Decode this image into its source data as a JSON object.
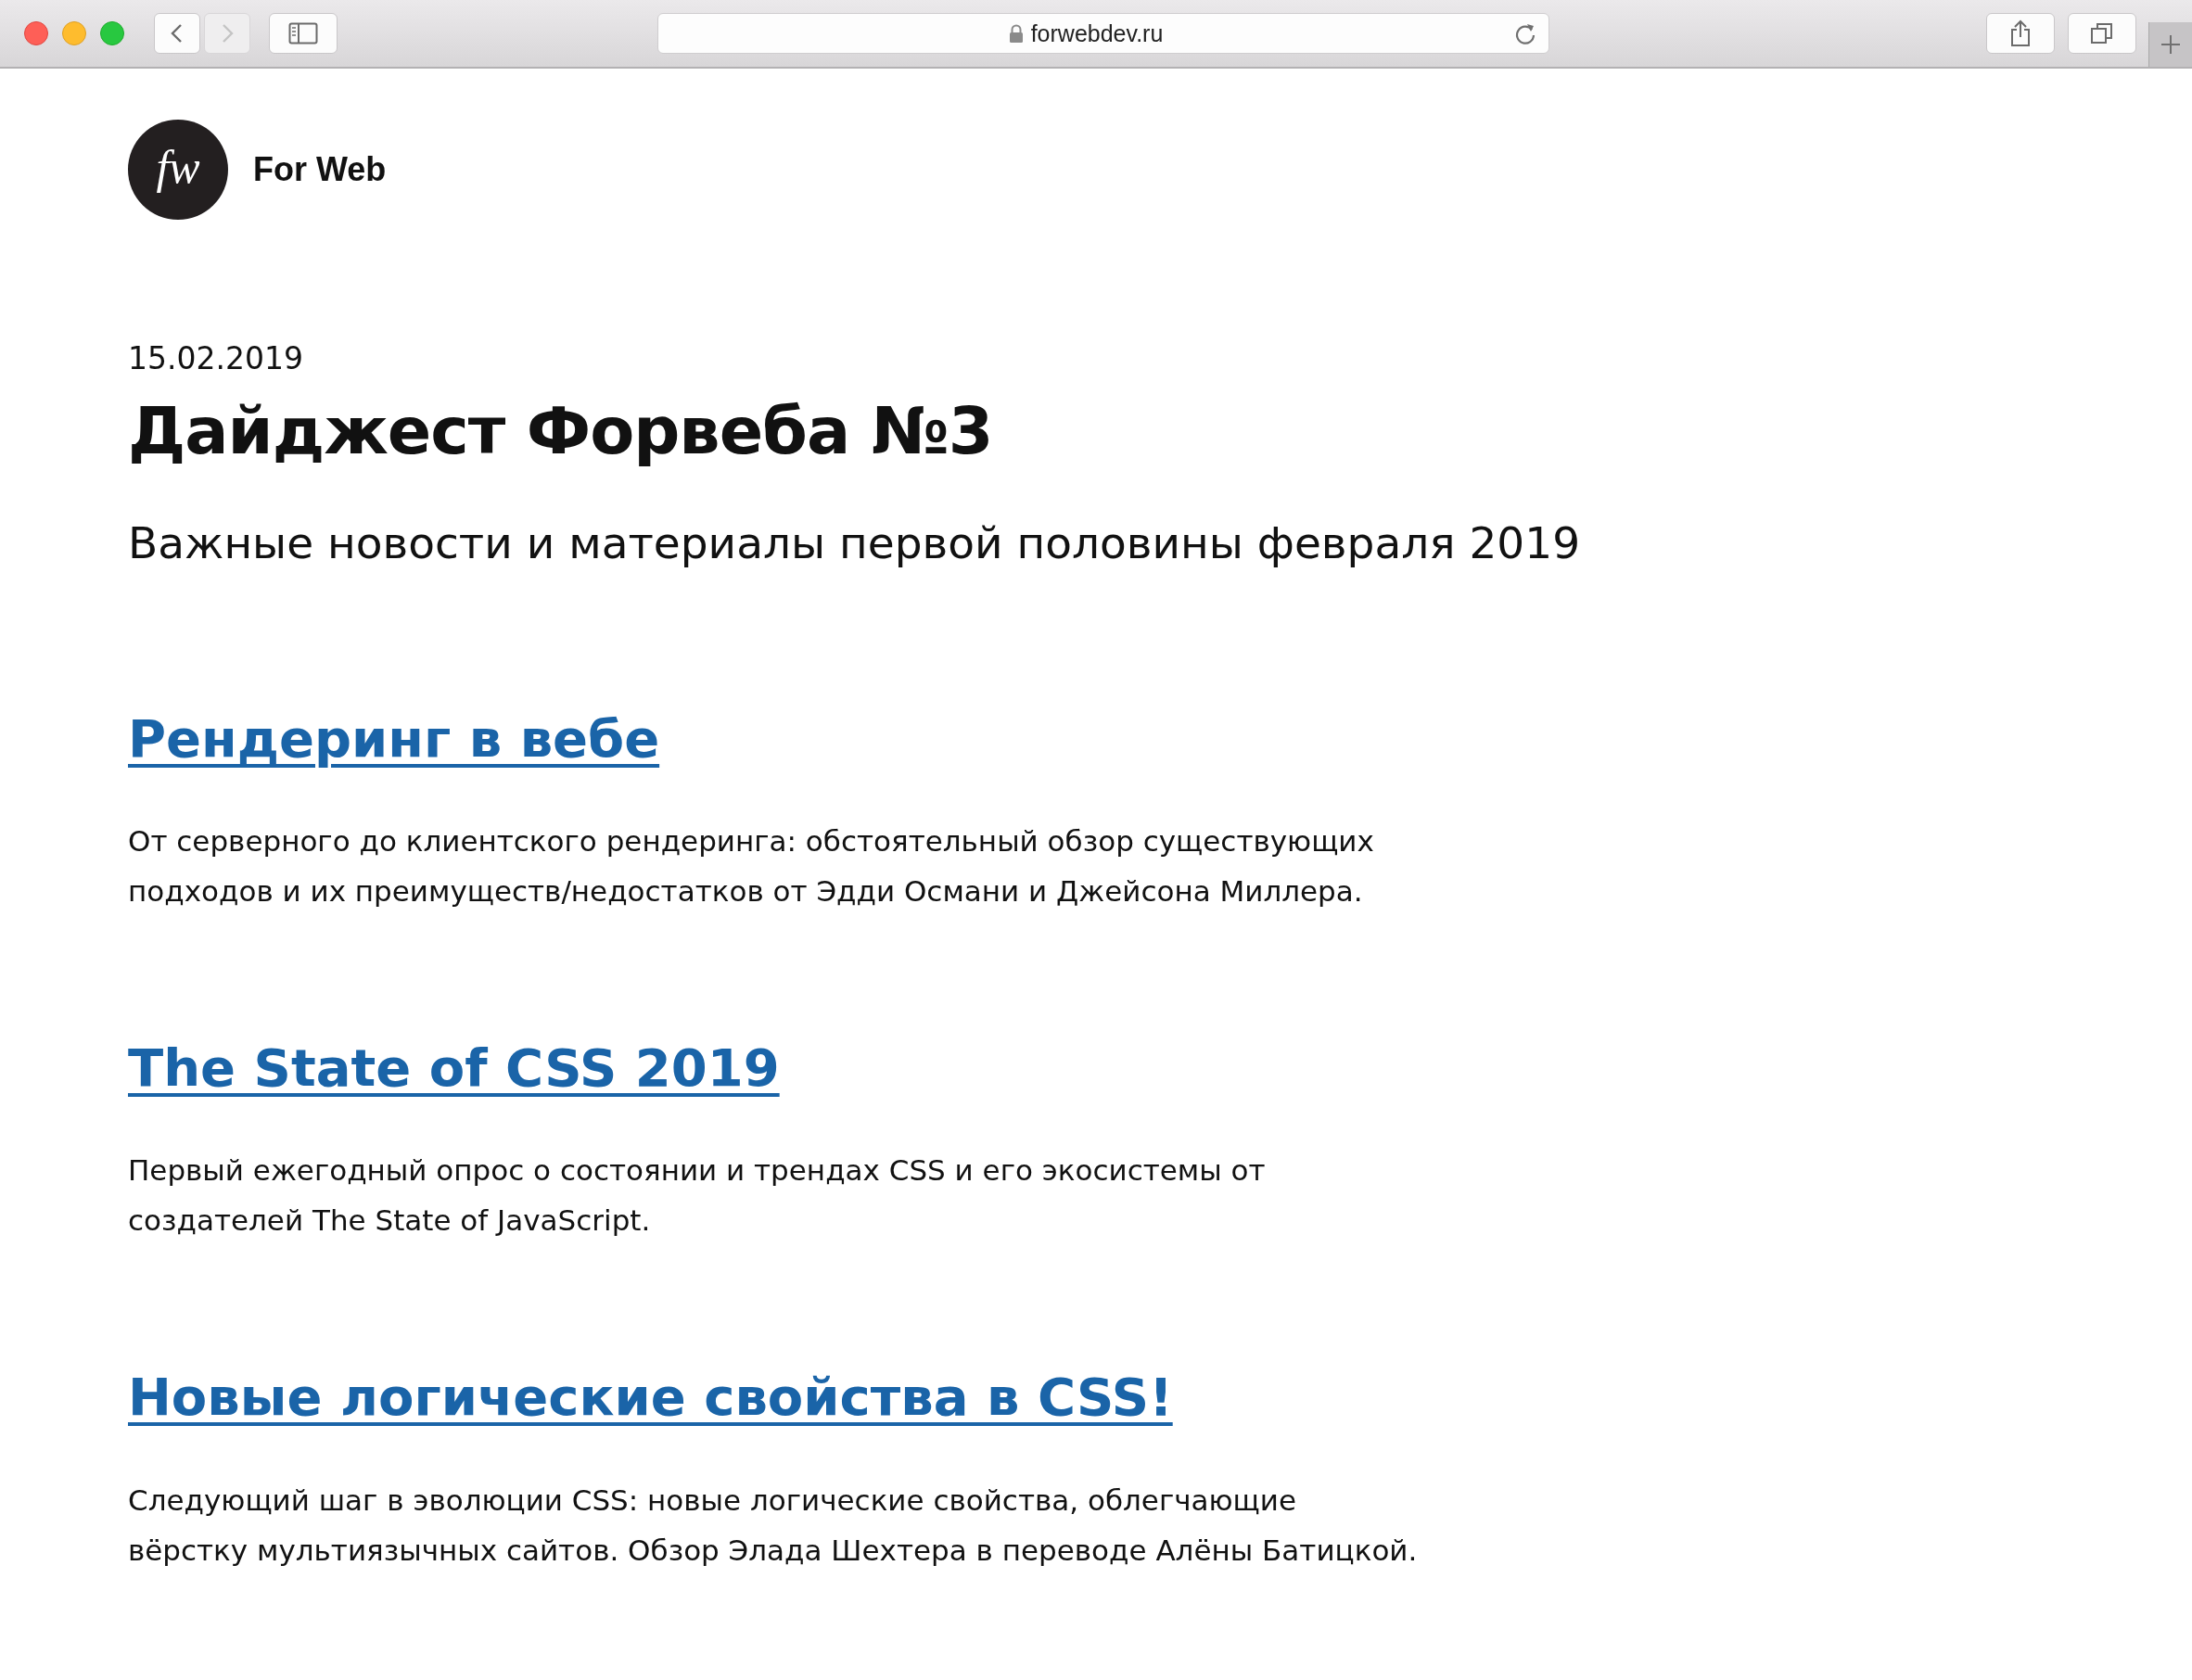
{
  "browser": {
    "address": "forwebdev.ru",
    "nav_buttons": [
      {
        "kind": "back",
        "disabled": false
      },
      {
        "kind": "forward",
        "disabled": true
      }
    ]
  },
  "header": {
    "logo_mark": "fw",
    "site_name": "For Web"
  },
  "article": {
    "date": "15.02.2019",
    "title": "Дайджест Форвеба №3",
    "subtitle": "Важные новости и материалы первой половины февраля 2019"
  },
  "items": [
    {
      "title": "Рендеринг в вебе",
      "lines": [
        "От серверного до клиентского рендеринга: обстоятельный обзор существующих",
        "подходов и их преимуществ/недостатков от Эдди Османи и Джейсона Миллера."
      ]
    },
    {
      "title": "The State of CSS 2019",
      "lines": [
        "Первый ежегодный опрос о состоянии и трендах CSS и его экосистемы от",
        "создателей The State of JavaScript."
      ]
    },
    {
      "title": "Новые логические свойства в CSS!",
      "lines": [
        "Следующий шаг в эволюции CSS: новые логические свойства, облегчающие",
        "вёрстку мультиязычных сайтов. Обзор Элада Шехтера в переводе Алёны Батицкой."
      ]
    }
  ]
}
